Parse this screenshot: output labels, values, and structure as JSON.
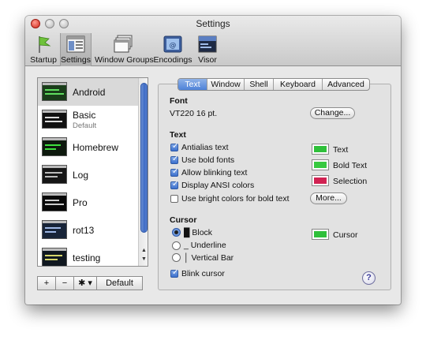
{
  "window": {
    "title": "Settings"
  },
  "toolbar": {
    "items": [
      {
        "label": "Startup",
        "icon": "flag-icon"
      },
      {
        "label": "Settings",
        "icon": "settings-window-icon",
        "selected": true
      },
      {
        "label": "Window Groups",
        "icon": "window-groups-icon"
      },
      {
        "label": "Encodings",
        "icon": "encodings-icon"
      },
      {
        "label": "Visor",
        "icon": "visor-icon"
      }
    ]
  },
  "profiles": {
    "items": [
      {
        "name": "Android",
        "subtitle": "",
        "selected": true
      },
      {
        "name": "Basic",
        "subtitle": "Default"
      },
      {
        "name": "Homebrew",
        "subtitle": ""
      },
      {
        "name": "Log",
        "subtitle": ""
      },
      {
        "name": "Pro",
        "subtitle": ""
      },
      {
        "name": "rot13",
        "subtitle": ""
      },
      {
        "name": "testing",
        "subtitle": ""
      }
    ],
    "buttons": {
      "add": "+",
      "remove": "−",
      "gear": "✱ ▾",
      "default": "Default"
    }
  },
  "tabs": {
    "items": [
      "Text",
      "Window",
      "Shell",
      "Keyboard",
      "Advanced"
    ],
    "active": "Text"
  },
  "font": {
    "heading": "Font",
    "value": "VT220 16 pt.",
    "change_button": "Change..."
  },
  "text": {
    "heading": "Text",
    "options": [
      {
        "label": "Antialias text",
        "checked": true
      },
      {
        "label": "Use bold fonts",
        "checked": true
      },
      {
        "label": "Allow blinking text",
        "checked": true
      },
      {
        "label": "Display ANSI colors",
        "checked": true
      },
      {
        "label": "Use bright colors for bold text",
        "checked": false
      }
    ],
    "colors": [
      {
        "label": "Text",
        "color": "#2fc03a"
      },
      {
        "label": "Bold Text",
        "color": "#37c940"
      },
      {
        "label": "Selection",
        "color": "#d12252"
      }
    ],
    "more_button": "More..."
  },
  "cursor": {
    "heading": "Cursor",
    "options": [
      {
        "label": "Block",
        "glyph": "█",
        "selected": true
      },
      {
        "label": "Underline",
        "glyph": "_",
        "selected": false
      },
      {
        "label": "Vertical Bar",
        "glyph": "│",
        "selected": false
      }
    ],
    "blink_label": "Blink cursor",
    "blink_checked": true,
    "color_label": "Cursor",
    "color": "#2fc03a"
  },
  "help": {
    "label": "?"
  }
}
